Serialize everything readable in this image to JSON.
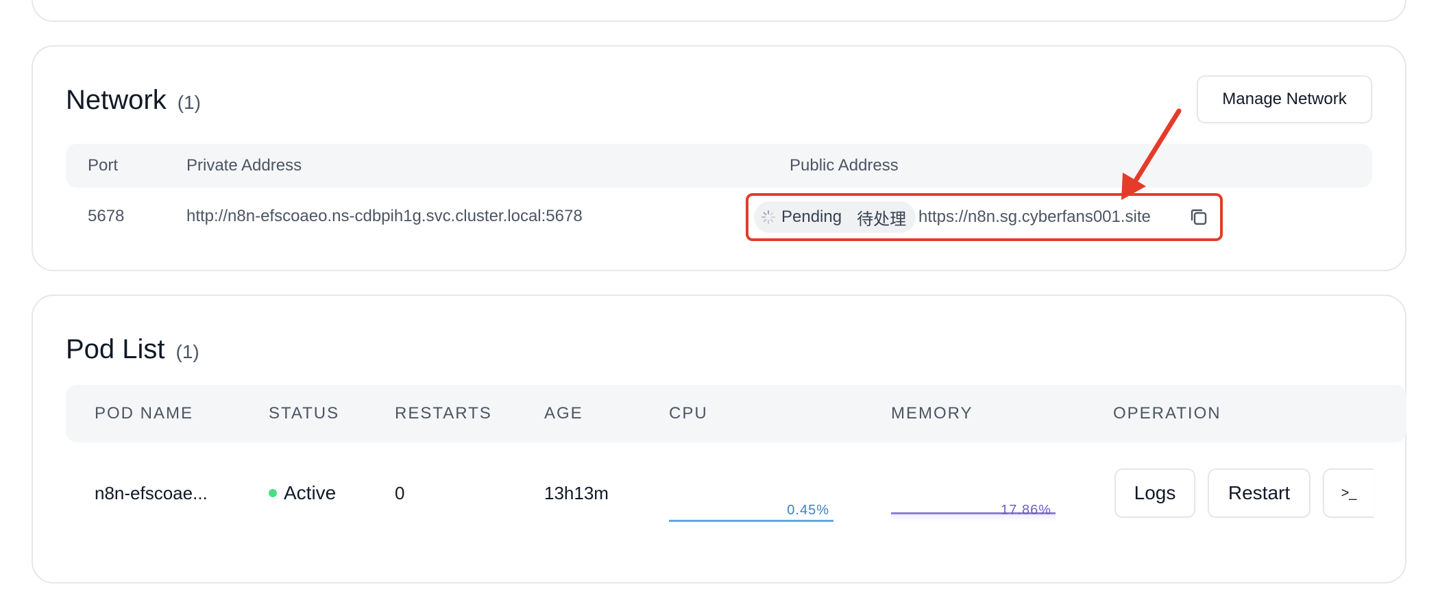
{
  "network": {
    "title": "Network",
    "count": "(1)",
    "manage_button": "Manage Network",
    "columns": [
      "Port",
      "Private Address",
      "Public Address"
    ],
    "row": {
      "port": "5678",
      "private_address": "http://n8n-efscoaeo.ns-cdbpih1g.svc.cluster.local:5678",
      "status_en": "Pending",
      "status_zh": "待处理",
      "public_address": "https://n8n.sg.cyberfans001.site"
    }
  },
  "pods": {
    "title": "Pod List",
    "count": "(1)",
    "columns": [
      "POD NAME",
      "STATUS",
      "RESTARTS",
      "AGE",
      "CPU",
      "MEMORY",
      "OPERATION"
    ],
    "rows": [
      {
        "name": "n8n-efscoae...",
        "status": "Active",
        "restarts": "0",
        "age": "13h13m",
        "cpu": "0.45%",
        "memory": "17.86%",
        "logs_button": "Logs",
        "restart_button": "Restart",
        "terminal_button": ">_"
      }
    ]
  },
  "colors": {
    "highlight": "#e53b2a",
    "cpu_line": "#5aa9e6",
    "memory_line": "#8b7fd6",
    "active_dot": "#4ade80"
  },
  "icons": {
    "spinner": "loading-spinner-icon",
    "copy": "copy-icon",
    "annotation": "red-arrow-annotation"
  }
}
